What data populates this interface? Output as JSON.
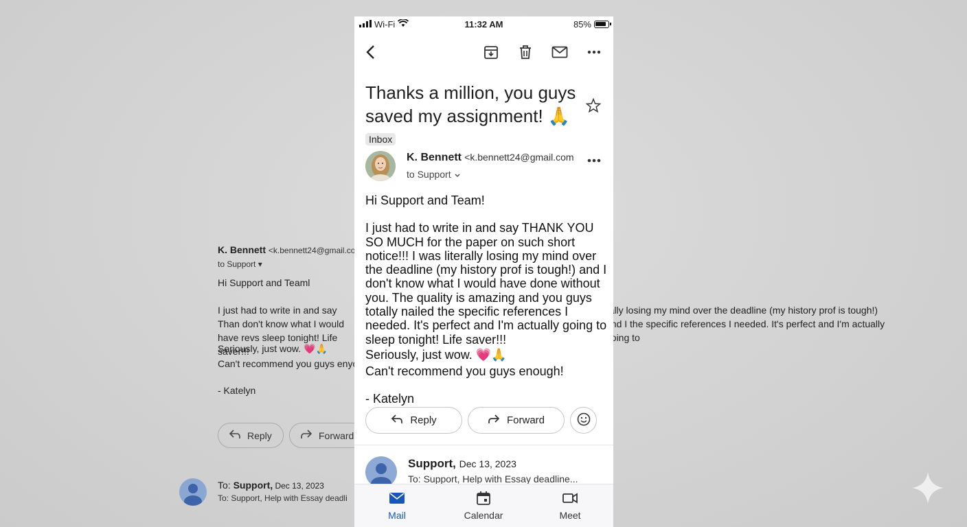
{
  "background": {
    "sender_name": "K. Bennett",
    "sender_addr": "<k.bennett24@gmail.co",
    "to": "to Support",
    "greeting": "Hi Support and Teaml",
    "para_left": "I just had to write in and say Than don't know what I would have revs sleep tonight! Life saver!!!",
    "para_right": "rally losing my mind over the deadline (my history prof is tough!) and I the specific references I needed. It's perfect and I'm actually going to",
    "seriously": "Seriously, just wow. 💗🙏",
    "cant": "Can't recommend you guys enyou",
    "signature": "- Katelyn",
    "reply_label": "Reply",
    "forward_label": "Forward",
    "to_support": "To: ",
    "to_support_name": "Support,",
    "to_support_date": " Dec 13, 2023",
    "snippet": "To: Support, Help with Essay deadli"
  },
  "status_bar": {
    "carrier": "Wi-Fi",
    "time": "11:32 AM",
    "battery": "85%"
  },
  "email": {
    "subject": "Thanks a million, you guys saved my assignment! 🙏",
    "label": "Inbox",
    "sender_name": "K. Bennett",
    "sender_addr": "<k.bennett24@gmail.com",
    "to": "to Support",
    "greeting": "Hi Support and Team!",
    "paragraph": "I just had to write in and say THANK YOU SO MUCH for the paper on such short notice!!! I was literally losing my mind over the deadline (my history prof is tough!) and I don't know what I would have done without you. The quality is amazing and you guys totally nailed the specific references I needed. It's perfect and I'm actually going to sleep tonight! Life saver!!!",
    "seriously": "Seriously, just wow. 💗🙏",
    "cant_recommend": "Can't recommend you guys enough!",
    "signature": "- Katelyn"
  },
  "actions": {
    "reply_label": "Reply",
    "forward_label": "Forward"
  },
  "thread_reply": {
    "sender": "Support,",
    "date": "Dec 13, 2023",
    "snippet": "To: Support, Help with Essay deadline..."
  },
  "bottom_nav": [
    {
      "label": "Mail"
    },
    {
      "label": "Calendar"
    },
    {
      "label": "Meet"
    }
  ],
  "colors": {
    "accent": "#1a56b7",
    "background": "#d4d4d4"
  }
}
